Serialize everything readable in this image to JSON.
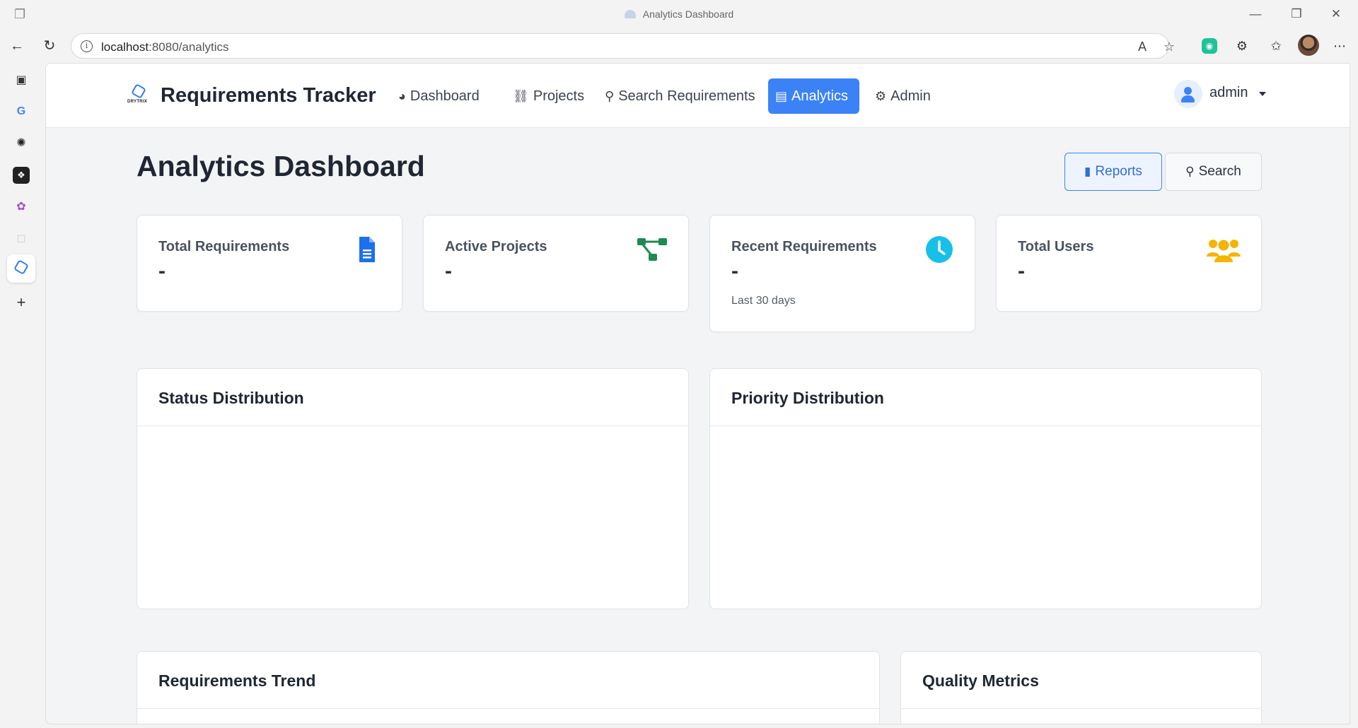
{
  "browser": {
    "window_title": "Analytics Dashboard",
    "url_host": "localhost",
    "url_path": ":8080/analytics"
  },
  "sidebar_icons": [
    "tabs-icon",
    "google-icon",
    "openai-icon",
    "app-icon",
    "brain-icon",
    "cube-icon",
    "drytrix-icon",
    "add-icon"
  ],
  "nav": {
    "brand_logo_text": "DRYTRIX",
    "brand": "Requirements Tracker",
    "links": [
      {
        "label": "Dashboard",
        "icon": "dashboard-icon"
      },
      {
        "label": "Projects",
        "icon": "projects-icon"
      },
      {
        "label": "Search Requirements",
        "icon": "search-icon"
      },
      {
        "label": "Analytics",
        "icon": "chart-icon",
        "active": true
      },
      {
        "label": "Admin",
        "icon": "gear-icon"
      }
    ],
    "user": "admin"
  },
  "page": {
    "title": "Analytics Dashboard",
    "reports_label": "Reports",
    "search_label": "Search"
  },
  "stats": [
    {
      "label": "Total Requirements",
      "value": "-",
      "sub": "",
      "icon": "document-icon",
      "color": "#1d6ff2"
    },
    {
      "label": "Active Projects",
      "value": "-",
      "sub": "",
      "icon": "project-tree-icon",
      "color": "#1e8a52"
    },
    {
      "label": "Recent Requirements",
      "value": "-",
      "sub": "Last 30 days",
      "icon": "clock-icon",
      "color": "#17c0e8"
    },
    {
      "label": "Total Users",
      "value": "-",
      "sub": "",
      "icon": "users-icon",
      "color": "#f5b400"
    }
  ],
  "panels": {
    "status": "Status Distribution",
    "priority": "Priority Distribution",
    "trend": "Requirements Trend",
    "quality": "Quality Metrics"
  },
  "colors": {
    "accent": "#3b82f6",
    "text": "#1f2733"
  }
}
